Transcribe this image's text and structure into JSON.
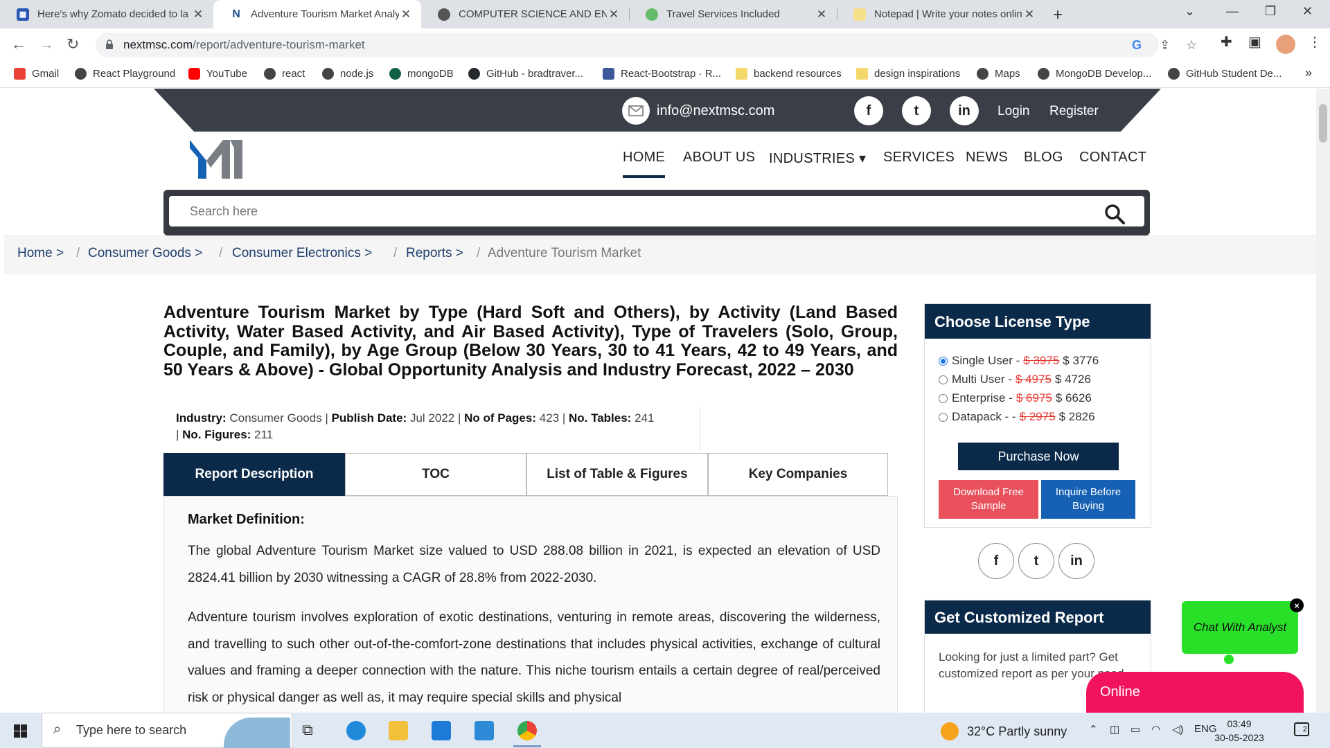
{
  "browser": {
    "tabs": [
      {
        "title": "Here's why Zomato decided to la",
        "color": "#2b57b3"
      },
      {
        "title": "Adventure Tourism Market Analy",
        "color": "#1f4e8c"
      },
      {
        "title": "COMPUTER SCIENCE AND ENGIN",
        "color": "#555555"
      },
      {
        "title": "Travel Services Included",
        "color": "#66bb6a"
      },
      {
        "title": "Notepad | Write your notes onlin",
        "color": "#f5e08c"
      }
    ],
    "url_domain": "nextmsc.com",
    "url_path": "/report/adventure-tourism-market",
    "bookmarks": [
      {
        "label": "Gmail",
        "color": "#ea4335"
      },
      {
        "label": "React Playground",
        "color": "#444444"
      },
      {
        "label": "YouTube",
        "color": "#ff0000"
      },
      {
        "label": "react",
        "color": "#444444"
      },
      {
        "label": "node.js",
        "color": "#444444"
      },
      {
        "label": "mongoDB",
        "color": "#116149"
      },
      {
        "label": "GitHub - bradtraver...",
        "color": "#24292e"
      },
      {
        "label": "React-Bootstrap · R...",
        "color": "#3b5998"
      },
      {
        "label": "backend resources",
        "color": "#f5d86a"
      },
      {
        "label": "design inspirations",
        "color": "#f5d86a"
      },
      {
        "label": "Maps",
        "color": "#444444"
      },
      {
        "label": "MongoDB Develop...",
        "color": "#444444"
      },
      {
        "label": "GitHub Student De...",
        "color": "#444444"
      }
    ],
    "more_bookmarks": "»"
  },
  "site": {
    "email": "info@nextmsc.com",
    "social": [
      "f",
      "t",
      "in"
    ],
    "login": "Login",
    "register": "Register",
    "nav": [
      "HOME",
      "ABOUT US",
      "INDUSTRIES ▾",
      "SERVICES",
      "NEWS",
      "BLOG",
      "CONTACT"
    ],
    "search_placeholder": "Search here",
    "accent": "#0b2a4a"
  },
  "breadcrumb": [
    "Home >",
    "Consumer Goods >",
    "Consumer Electronics >",
    "Reports >",
    "Adventure Tourism Market"
  ],
  "report": {
    "title": "Adventure Tourism Market by Type (Hard Soft and Others), by Activity (Land Based Activity, Water Based Activity, and Air Based Activity), Type of Travelers (Solo, Group, Couple, and Family), by Age Group (Below 30 Years, 30 to 41 Years, 42 to 49 Years, and 50 Years & Above) - Global Opportunity Analysis and Industry Forecast, 2022 – 2030",
    "meta": {
      "industry_label": "Industry:",
      "industry": "Consumer Goods",
      "publish_label": "Publish Date:",
      "publish": "Jul 2022",
      "pages_label": "No of Pages:",
      "pages": "423",
      "tables_label": "No. Tables:",
      "tables": "241",
      "figures_label": "No. Figures:",
      "figures": "211"
    },
    "tabs": [
      "Report Description",
      "TOC",
      "List of Table & Figures",
      "Key Companies"
    ],
    "market_definition": "Market Definition:",
    "para1": "The global Adventure Tourism Market size valued to USD 288.08 billion in 2021, is expected an elevation of USD 2824.41 billion by 2030 witnessing a CAGR of 28.8% from 2022-2030.",
    "para2": "Adventure tourism involves exploration of exotic destinations, venturing in remote areas, discovering the wilderness, and travelling to such other out-of-the-comfort-zone destinations that includes physical activities, exchange of cultural values and framing a deeper connection with the nature. This niche tourism entails a certain degree of real/perceived risk or physical danger as well as, it may require special skills and physical"
  },
  "license": {
    "title": "Choose License Type",
    "options": [
      {
        "name": "Single User -",
        "old": "$ 3975",
        "new": "$ 3776",
        "selected": true
      },
      {
        "name": "Multi User -",
        "old": "$ 4975",
        "new": "$ 4726",
        "selected": false
      },
      {
        "name": "Enterprise -",
        "old": "$ 6975",
        "new": "$ 6626",
        "selected": false
      },
      {
        "name": "Datapack - -",
        "old": "$ 2975",
        "new": "$ 2826",
        "selected": false
      }
    ],
    "purchase": "Purchase Now",
    "download_l1": "Download Free",
    "download_l2": "Sample",
    "inquire_l1": "Inquire Before",
    "inquire_l2": "Buying"
  },
  "custom": {
    "title": "Get Customized Report",
    "text": "Looking for just a limited part? Get customized report as per your need."
  },
  "chat": {
    "label": "Chat With Analyst",
    "close": "×",
    "online": "Online"
  },
  "taskbar": {
    "search_placeholder": "Type here to search",
    "weather": "32°C  Partly sunny",
    "lang": "ENG",
    "time": "03:49",
    "date": "30-05-2023",
    "notifications": "2"
  }
}
